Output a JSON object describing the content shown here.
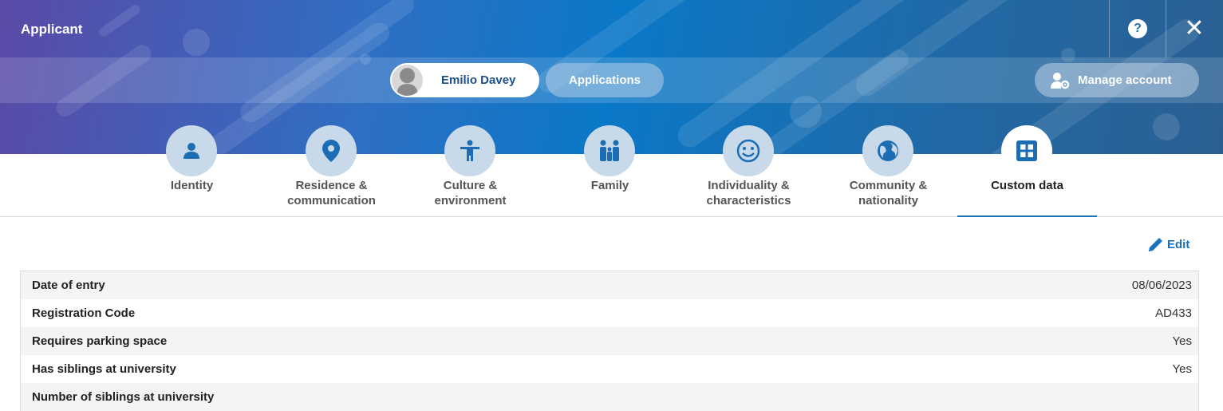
{
  "window": {
    "title": "Applicant"
  },
  "header": {
    "person_name": "Emilio Davey",
    "applications_label": "Applications",
    "manage_account_label": "Manage account"
  },
  "tabs": [
    {
      "label": "Identity",
      "icon": "person-icon"
    },
    {
      "label": "Residence &\ncommunication",
      "icon": "location-pin-icon"
    },
    {
      "label": "Culture &\nenvironment",
      "icon": "accessibility-icon"
    },
    {
      "label": "Family",
      "icon": "family-icon"
    },
    {
      "label": "Individuality &\ncharacteristics",
      "icon": "smiley-icon"
    },
    {
      "label": "Community &\nnationality",
      "icon": "globe-icon"
    },
    {
      "label": "Custom data",
      "icon": "grid-icon",
      "active": true
    }
  ],
  "actions": {
    "edit_label": "Edit"
  },
  "details": [
    {
      "label": "Date of entry",
      "value": "08/06/2023"
    },
    {
      "label": "Registration Code",
      "value": "AD433"
    },
    {
      "label": "Requires parking space",
      "value": "Yes"
    },
    {
      "label": "Has siblings at university",
      "value": "Yes"
    },
    {
      "label": "Number of siblings at university",
      "value": ""
    }
  ],
  "colors": {
    "accent": "#1a72bb",
    "tab_icon_bg": "#c8daea"
  }
}
